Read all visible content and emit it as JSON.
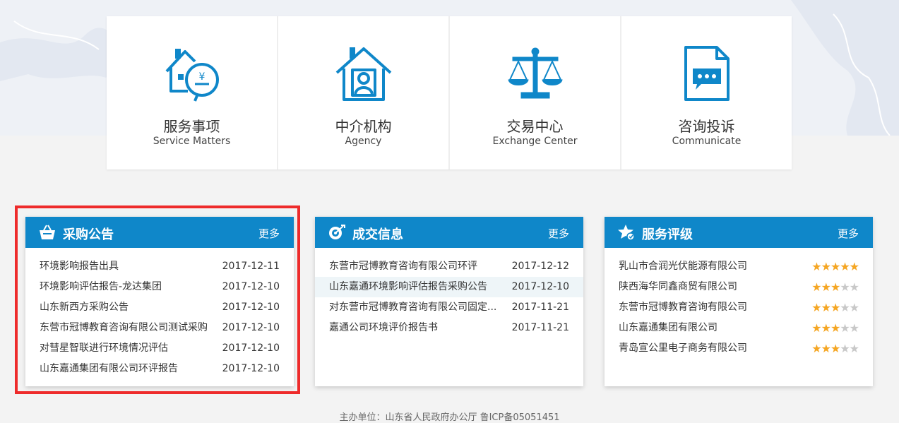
{
  "services": [
    {
      "cn": "服务事项",
      "en": "Service Matters",
      "icon": "house-service-icon"
    },
    {
      "cn": "中介机构",
      "en": "Agency",
      "icon": "house-person-icon"
    },
    {
      "cn": "交易中心",
      "en": "Exchange Center",
      "icon": "scales-icon"
    },
    {
      "cn": "咨询投诉",
      "en": "Communicate",
      "icon": "document-chat-icon"
    }
  ],
  "panels": {
    "procurement": {
      "title": "采购公告",
      "more": "更多",
      "icon": "basket-icon",
      "items": [
        {
          "title": "环境影响报告出具",
          "date": "2017-12-11"
        },
        {
          "title": "环境影响评估报告-龙达集团",
          "date": "2017-12-10"
        },
        {
          "title": "山东新西方采购公告",
          "date": "2017-12-10"
        },
        {
          "title": "东营市冠博教育咨询有限公司测试采购",
          "date": "2017-12-10"
        },
        {
          "title": "对彗星智联进行环境情况评估",
          "date": "2017-12-10"
        },
        {
          "title": "山东嘉通集团有限公司环评报告",
          "date": "2017-12-10"
        }
      ]
    },
    "deals": {
      "title": "成交信息",
      "more": "更多",
      "icon": "target-icon",
      "items": [
        {
          "title": "东营市冠博教育咨询有限公司环评",
          "date": "2017-12-12"
        },
        {
          "title": "山东嘉通环境影响评估报告采购公告",
          "date": "2017-12-10"
        },
        {
          "title": "对东营市冠博教育咨询有限公司固定...",
          "date": "2017-11-21"
        },
        {
          "title": "嘉通公司环境评价报告书",
          "date": "2017-11-21"
        }
      ]
    },
    "rating": {
      "title": "服务评级",
      "more": "更多",
      "icon": "star-badge-icon",
      "items": [
        {
          "title": "乳山市合润光伏能源有限公司",
          "stars": 5
        },
        {
          "title": "陕西海华同鑫商贸有限公司",
          "stars": 3
        },
        {
          "title": "东营市冠博教育咨询有限公司",
          "stars": 3
        },
        {
          "title": "山东嘉通集团有限公司",
          "stars": 3
        },
        {
          "title": "青岛宣公里电子商务有限公司",
          "stars": 3
        }
      ]
    }
  },
  "footer": "主办单位：山东省人民政府办公厅 鲁ICP备05051451",
  "colors": {
    "accent": "#0f87c9",
    "highlight": "#ee2b2b",
    "star": "#f5a623"
  }
}
